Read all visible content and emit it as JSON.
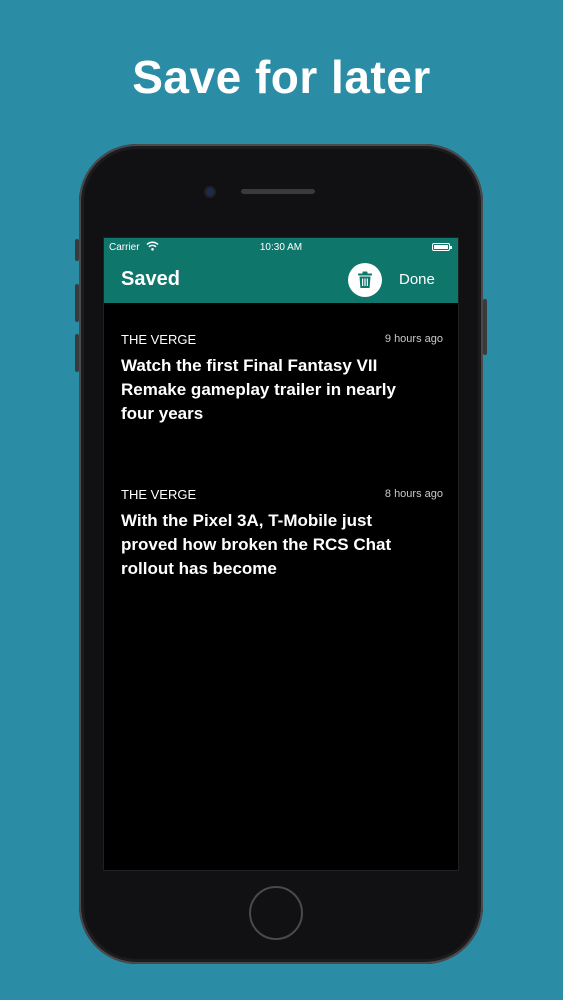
{
  "promo": {
    "title": "Save for later"
  },
  "status_bar": {
    "carrier": "Carrier",
    "time": "10:30 AM"
  },
  "nav": {
    "title": "Saved",
    "done_label": "Done"
  },
  "articles": [
    {
      "source": "THE VERGE",
      "time": "9 hours ago",
      "headline": "Watch the first Final Fantasy VII Remake gameplay trailer in nearly four years"
    },
    {
      "source": "THE VERGE",
      "time": "8 hours ago",
      "headline": "With the Pixel 3A, T-Mobile just proved how broken the RCS Chat rollout has become"
    }
  ],
  "colors": {
    "background": "#2b8ca6",
    "nav_bar": "#0f766b",
    "screen": "#000000"
  },
  "icons": [
    "wifi-icon",
    "battery-icon",
    "trash-icon"
  ]
}
